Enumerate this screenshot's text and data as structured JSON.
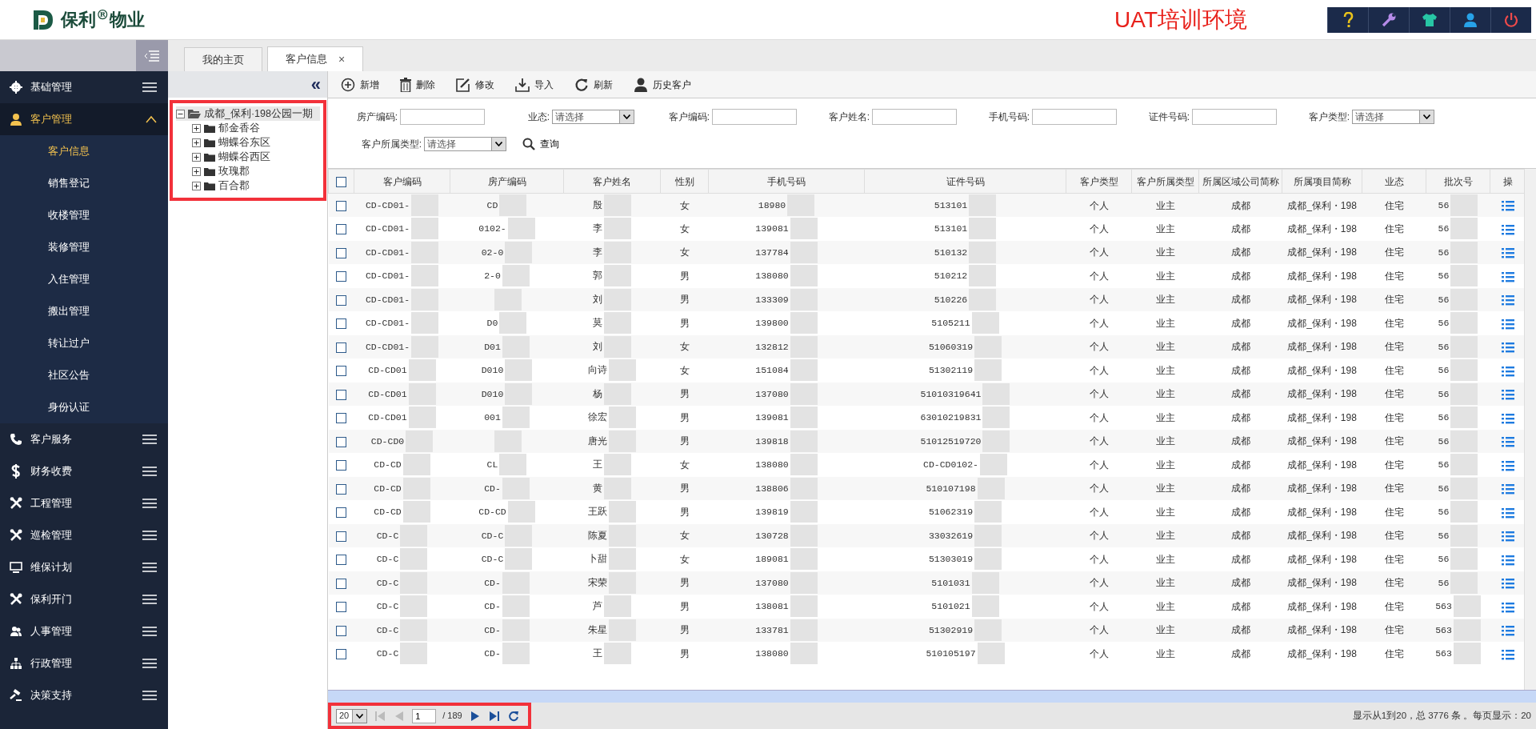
{
  "header": {
    "logo_text": "保利$^{®}$物业",
    "environment": "UAT培训环境"
  },
  "sidebar": {
    "items": [
      {
        "label": "基础管理",
        "expanded": false
      },
      {
        "label": "客户管理",
        "expanded": true,
        "children": [
          {
            "label": "客户信息",
            "selected": true
          },
          {
            "label": "销售登记",
            "selected": false
          },
          {
            "label": "收楼管理",
            "selected": false
          },
          {
            "label": "装修管理",
            "selected": false
          },
          {
            "label": "入住管理",
            "selected": false
          },
          {
            "label": "搬出管理",
            "selected": false
          },
          {
            "label": "转让过户",
            "selected": false
          },
          {
            "label": "社区公告",
            "selected": false
          },
          {
            "label": "身份认证",
            "selected": false
          }
        ]
      },
      {
        "label": "客户服务",
        "expanded": false
      },
      {
        "label": "财务收费",
        "expanded": false
      },
      {
        "label": "工程管理",
        "expanded": false
      },
      {
        "label": "巡检管理",
        "expanded": false
      },
      {
        "label": "维保计划",
        "expanded": false
      },
      {
        "label": "保利开门",
        "expanded": false
      },
      {
        "label": "人事管理",
        "expanded": false
      },
      {
        "label": "行政管理",
        "expanded": false
      },
      {
        "label": "决策支持",
        "expanded": false
      }
    ]
  },
  "tabs": [
    {
      "label": "我的主页",
      "selected": false
    },
    {
      "label": "客户信息",
      "selected": true,
      "close_label": "×"
    }
  ],
  "tree": {
    "highlighted": true,
    "collapse_label": "«",
    "nodes": [
      {
        "label": "成都_保利·198公园一期",
        "expanded": true,
        "children": [
          {
            "label": "郁金香谷",
            "expanded": false
          },
          {
            "label": "蝴蝶谷东区",
            "expanded": false
          },
          {
            "label": "蝴蝶谷西区",
            "expanded": false
          },
          {
            "label": "玫瑰郡",
            "expanded": false
          },
          {
            "label": "百合郡",
            "expanded": false
          }
        ]
      }
    ]
  },
  "toolbar": [
    {
      "label": "新增"
    },
    {
      "label": "删除"
    },
    {
      "label": "修改"
    },
    {
      "label": "导入"
    },
    {
      "label": "刷新"
    },
    {
      "label": "历史客户"
    }
  ],
  "filters": [
    {
      "label": "房产编码:",
      "kind": "text"
    },
    {
      "label": "业态:",
      "kind": "select",
      "value": "请选择"
    },
    {
      "label": "客户编码:",
      "kind": "text"
    },
    {
      "label": "客户姓名:",
      "kind": "text"
    },
    {
      "label": "手机号码:",
      "kind": "text"
    },
    {
      "label": "证件号码:",
      "kind": "text"
    },
    {
      "label": "客户类型:",
      "kind": "select",
      "value": "请选择"
    },
    {
      "label": "客户所属类型:",
      "kind": "select",
      "value": "请选择"
    }
  ],
  "search_button": "查询",
  "table": {
    "select_all_checked": false,
    "columns": [
      "客户编码",
      "房产编码",
      "客户姓名",
      "性别",
      "手机号码",
      "证件号码",
      "客户类型",
      "客户所属类型",
      "所属区域公司简称",
      "所属项目简称",
      "业态",
      "批次号",
      "操"
    ],
    "rows": [
      {
        "checked": false,
        "cells": [
          "CD-CD01-",
          "CD",
          "殷",
          "女",
          "18980",
          "513101",
          "个人",
          "业主",
          "成都",
          "成都_保利・198",
          "住宅",
          "56"
        ]
      },
      {
        "checked": false,
        "cells": [
          "CD-CD01-",
          "0102-",
          "李",
          "女",
          "139081",
          "513101",
          "个人",
          "业主",
          "成都",
          "成都_保利・198",
          "住宅",
          "56"
        ]
      },
      {
        "checked": false,
        "cells": [
          "CD-CD01-",
          "02-0",
          "李",
          "女",
          "137784",
          "510132",
          "个人",
          "业主",
          "成都",
          "成都_保利・198",
          "住宅",
          "56"
        ]
      },
      {
        "checked": false,
        "cells": [
          "CD-CD01-",
          "2-0",
          "郭",
          "男",
          "138080",
          "510212",
          "个人",
          "业主",
          "成都",
          "成都_保利・198",
          "住宅",
          "56"
        ]
      },
      {
        "checked": false,
        "cells": [
          "CD-CD01-",
          "",
          "刘",
          "男",
          "133309",
          "510226",
          "个人",
          "业主",
          "成都",
          "成都_保利・198",
          "住宅",
          "56"
        ]
      },
      {
        "checked": false,
        "cells": [
          "CD-CD01-",
          "D0",
          "莫",
          "男",
          "139800",
          "5105211",
          "个人",
          "业主",
          "成都",
          "成都_保利・198",
          "住宅",
          "56"
        ]
      },
      {
        "checked": false,
        "cells": [
          "CD-CD01-",
          "D01",
          "刘",
          "女",
          "132812",
          "51060319",
          "个人",
          "业主",
          "成都",
          "成都_保利・198",
          "住宅",
          "56"
        ]
      },
      {
        "checked": false,
        "cells": [
          "CD-CD01",
          "D010",
          "向诗",
          "女",
          "151084",
          "51302119",
          "个人",
          "业主",
          "成都",
          "成都_保利・198",
          "住宅",
          "56"
        ]
      },
      {
        "checked": false,
        "cells": [
          "CD-CD01",
          "D010",
          "杨",
          "男",
          "137080",
          "51010319641",
          "个人",
          "业主",
          "成都",
          "成都_保利・198",
          "住宅",
          "56"
        ]
      },
      {
        "checked": false,
        "cells": [
          "CD-CD01",
          "001",
          "徐宏",
          "男",
          "139081",
          "63010219831",
          "个人",
          "业主",
          "成都",
          "成都_保利・198",
          "住宅",
          "56"
        ]
      },
      {
        "checked": false,
        "cells": [
          "CD-CD0",
          "",
          "唐光",
          "男",
          "139818",
          "51012519720",
          "个人",
          "业主",
          "成都",
          "成都_保利・198",
          "住宅",
          "56"
        ]
      },
      {
        "checked": false,
        "cells": [
          "CD-CD",
          "CL",
          "王",
          "女",
          "138080",
          "CD-CD0102-",
          "个人",
          "业主",
          "成都",
          "成都_保利・198",
          "住宅",
          "56"
        ]
      },
      {
        "checked": false,
        "cells": [
          "CD-CD",
          "CD-",
          "黄",
          "男",
          "138806",
          "510107198",
          "个人",
          "业主",
          "成都",
          "成都_保利・198",
          "住宅",
          "56"
        ]
      },
      {
        "checked": false,
        "cells": [
          "CD-CD",
          "CD-CD",
          "王跃",
          "男",
          "139819",
          "51062319",
          "个人",
          "业主",
          "成都",
          "成都_保利・198",
          "住宅",
          "56"
        ]
      },
      {
        "checked": false,
        "cells": [
          "CD-C",
          "CD-C",
          "陈夏",
          "女",
          "130728",
          "33032619",
          "个人",
          "业主",
          "成都",
          "成都_保利・198",
          "住宅",
          "56"
        ]
      },
      {
        "checked": false,
        "cells": [
          "CD-C",
          "CD-C",
          "卜甜",
          "女",
          "189081",
          "51303019",
          "个人",
          "业主",
          "成都",
          "成都_保利・198",
          "住宅",
          "56"
        ]
      },
      {
        "checked": false,
        "cells": [
          "CD-C",
          "CD-",
          "宋荣",
          "男",
          "137080",
          "5101031",
          "个人",
          "业主",
          "成都",
          "成都_保利・198",
          "住宅",
          "56"
        ]
      },
      {
        "checked": false,
        "cells": [
          "CD-C",
          "CD-",
          "芦",
          "男",
          "138081",
          "5101021",
          "个人",
          "业主",
          "成都",
          "成都_保利・198",
          "住宅",
          "563"
        ]
      },
      {
        "checked": false,
        "cells": [
          "CD-C",
          "CD-",
          "朱星",
          "男",
          "133781",
          "51302919",
          "个人",
          "业主",
          "成都",
          "成都_保利・198",
          "住宅",
          "563"
        ]
      },
      {
        "checked": false,
        "cells": [
          "CD-C",
          "CD-",
          "王",
          "男",
          "138080",
          "510105197",
          "个人",
          "业主",
          "成都",
          "成都_保利・198",
          "住宅",
          "563"
        ]
      }
    ]
  },
  "pager": {
    "highlighted": true,
    "page_size": "20",
    "page": "1",
    "total_pages": "/ 189",
    "info": "显示从1到20，总 3776 条 。每页显示：20"
  }
}
